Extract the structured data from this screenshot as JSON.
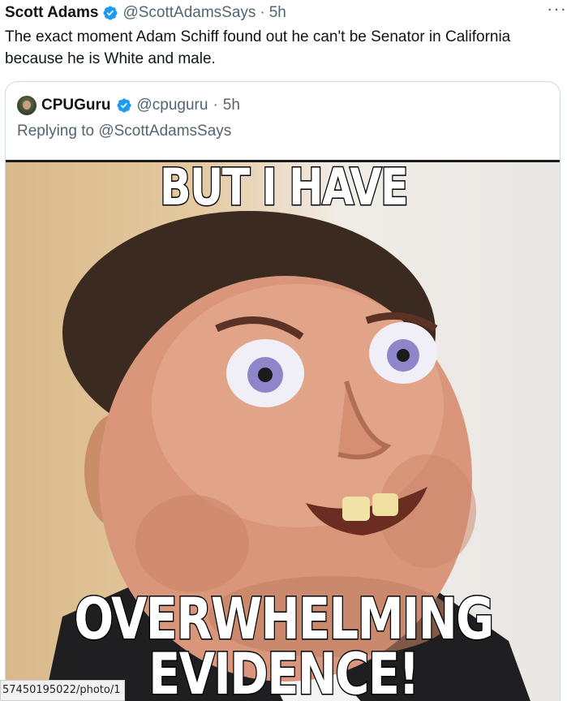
{
  "tweet": {
    "author_name": "Scott Adams",
    "author_handle": "@ScottAdamsSays",
    "separator": "·",
    "time": "5h",
    "more_label": "···",
    "text": "The exact moment Adam Schiff found out he can't be Senator in California because he is White and male."
  },
  "quote": {
    "author_name": "CPUGuru",
    "author_handle": "@cpuguru",
    "separator": "·",
    "time": "5h",
    "replying_to": "Replying to @ScottAdamsSays",
    "image": {
      "caption_top": "BUT I HAVE",
      "caption_bottom_line1": "OVERWHELMING",
      "caption_bottom_line2": "EVIDENCE!"
    }
  },
  "status_bar": {
    "url_fragment": "57450195022/photo/1"
  },
  "colors": {
    "verified": "#1d9bf0",
    "text": "#0f1419",
    "secondary": "#536471",
    "border": "#cfd9de"
  }
}
